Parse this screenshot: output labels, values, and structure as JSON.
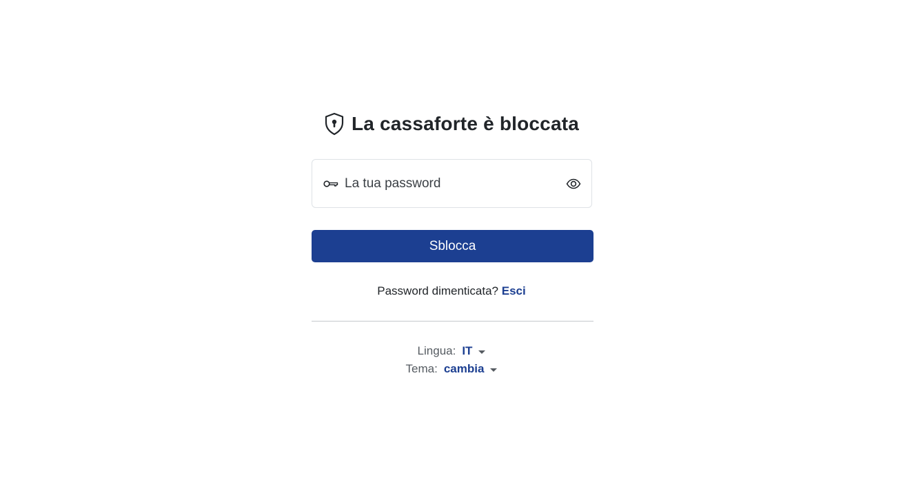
{
  "header": {
    "title": "La cassaforte è bloccata",
    "icon": "shield-keyhole-icon"
  },
  "password": {
    "placeholder": "La tua password",
    "value": "",
    "icon": "key-icon",
    "toggle_icon": "eye-icon"
  },
  "unlock_button": {
    "label": "Sblocca"
  },
  "forgot": {
    "text": "Password dimenticata?",
    "link_label": "Esci"
  },
  "settings": {
    "language_label": "Lingua:",
    "language_value": "IT",
    "theme_label": "Tema:",
    "theme_value": "cambia"
  },
  "colors": {
    "accent": "#1c3f91",
    "border": "#dee2e6",
    "divider": "#c4c8cc",
    "text": "#212529"
  }
}
